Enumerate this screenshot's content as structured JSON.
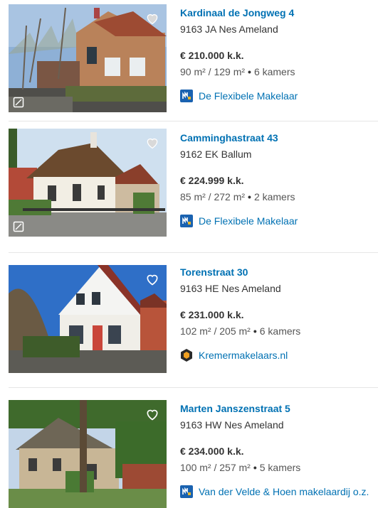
{
  "colors": {
    "link": "#0071b3",
    "text": "#333333",
    "muted": "#555555"
  },
  "listings": [
    {
      "street": "Kardinaal de Jongweg 4",
      "zip": "9163 JA Nes Ameland",
      "price": "€ 210.000 k.k.",
      "living_area": "90 m² / 129 m²",
      "rooms": "6 kamers",
      "agent": "De Flexibele Makelaar",
      "agent_logo": "nvm-logo",
      "favorite_icon": "heart-icon",
      "media_icon": "media-icon"
    },
    {
      "street": "Camminghastraat 43",
      "zip": "9162 EK Ballum",
      "price": "€ 224.999 k.k.",
      "living_area": "85 m² / 272 m²",
      "rooms": "2 kamers",
      "agent": "De Flexibele Makelaar",
      "agent_logo": "nvm-logo",
      "favorite_icon": "heart-icon",
      "media_icon": "media-icon"
    },
    {
      "street": "Torenstraat 30",
      "zip": "9163 HE Nes Ameland",
      "price": "€ 231.000 k.k.",
      "living_area": "102 m² / 205 m²",
      "rooms": "6 kamers",
      "agent": "Kremermakelaars.nl",
      "agent_logo": "vbo-logo",
      "favorite_icon": "heart-icon"
    },
    {
      "street": "Marten Janszenstraat 5",
      "zip": "9163 HW Nes Ameland",
      "price": "€ 234.000 k.k.",
      "living_area": "100 m² / 257 m²",
      "rooms": "5 kamers",
      "agent": "Van der Velde & Hoen makelaardij o.z.",
      "agent_logo": "nvm-logo",
      "favorite_icon": "heart-icon"
    }
  ]
}
